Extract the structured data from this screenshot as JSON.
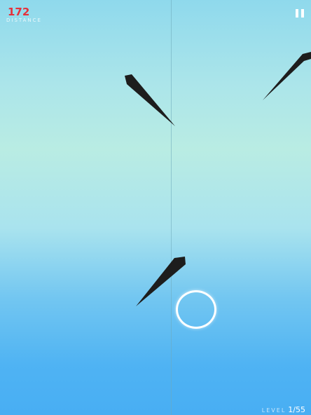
{
  "hud": {
    "score": "172",
    "distance_label": "DISTANCE",
    "level_label": "LEVEL",
    "level_value": "1/55"
  },
  "icons": {
    "pause": "pause-icon"
  },
  "colors": {
    "score": "#e5303a",
    "spike": "#1d1d1d",
    "ring": "#ffffff",
    "sky_top": "#8fd9ec",
    "sky_bottom": "#48aef3"
  }
}
